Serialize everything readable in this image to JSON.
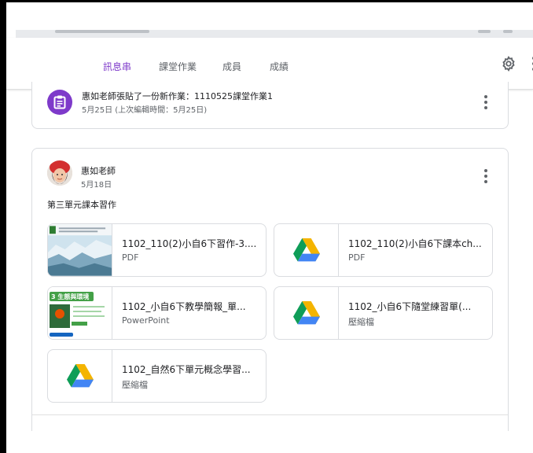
{
  "tabs": [
    {
      "label": "訊息串",
      "active": true
    },
    {
      "label": "課堂作業",
      "active": false
    },
    {
      "label": "成員",
      "active": false
    },
    {
      "label": "成績",
      "active": false
    }
  ],
  "header_icons": [
    "gear-icon",
    "more-vert-icon"
  ],
  "announcement": {
    "title": "惠如老師張貼了一份新作業：1110525課堂作業1",
    "subtitle": "5月25日 (上次編輯時間：5月25日)",
    "icon": "assignment-icon"
  },
  "post": {
    "author": "惠如老師",
    "date": "5月18日",
    "text": "第三單元課本習作",
    "attachments": [
      {
        "title": "1102_110(2)小自6下習作-3....",
        "type": "PDF",
        "thumb": "image-thumbnail"
      },
      {
        "title": "1102_110(2)小自6下課本ch...",
        "type": "PDF",
        "thumb": "drive-icon"
      },
      {
        "title": "1102_小自6下教學簡報_單...",
        "type": "PowerPoint",
        "thumb": "slide-thumbnail",
        "thumb_text": "3 生態與環境"
      },
      {
        "title": "1102_小自6下隨堂練習單(...",
        "type": "壓縮檔",
        "thumb": "drive-icon"
      },
      {
        "title": "1102_自然6下單元概念學習...",
        "type": "壓縮檔",
        "thumb": "drive-icon"
      }
    ]
  },
  "colors": {
    "accent": "#7e3aca",
    "drive_green": "#0f9d58",
    "drive_yellow": "#f4b400",
    "drive_blue": "#4285f4"
  }
}
